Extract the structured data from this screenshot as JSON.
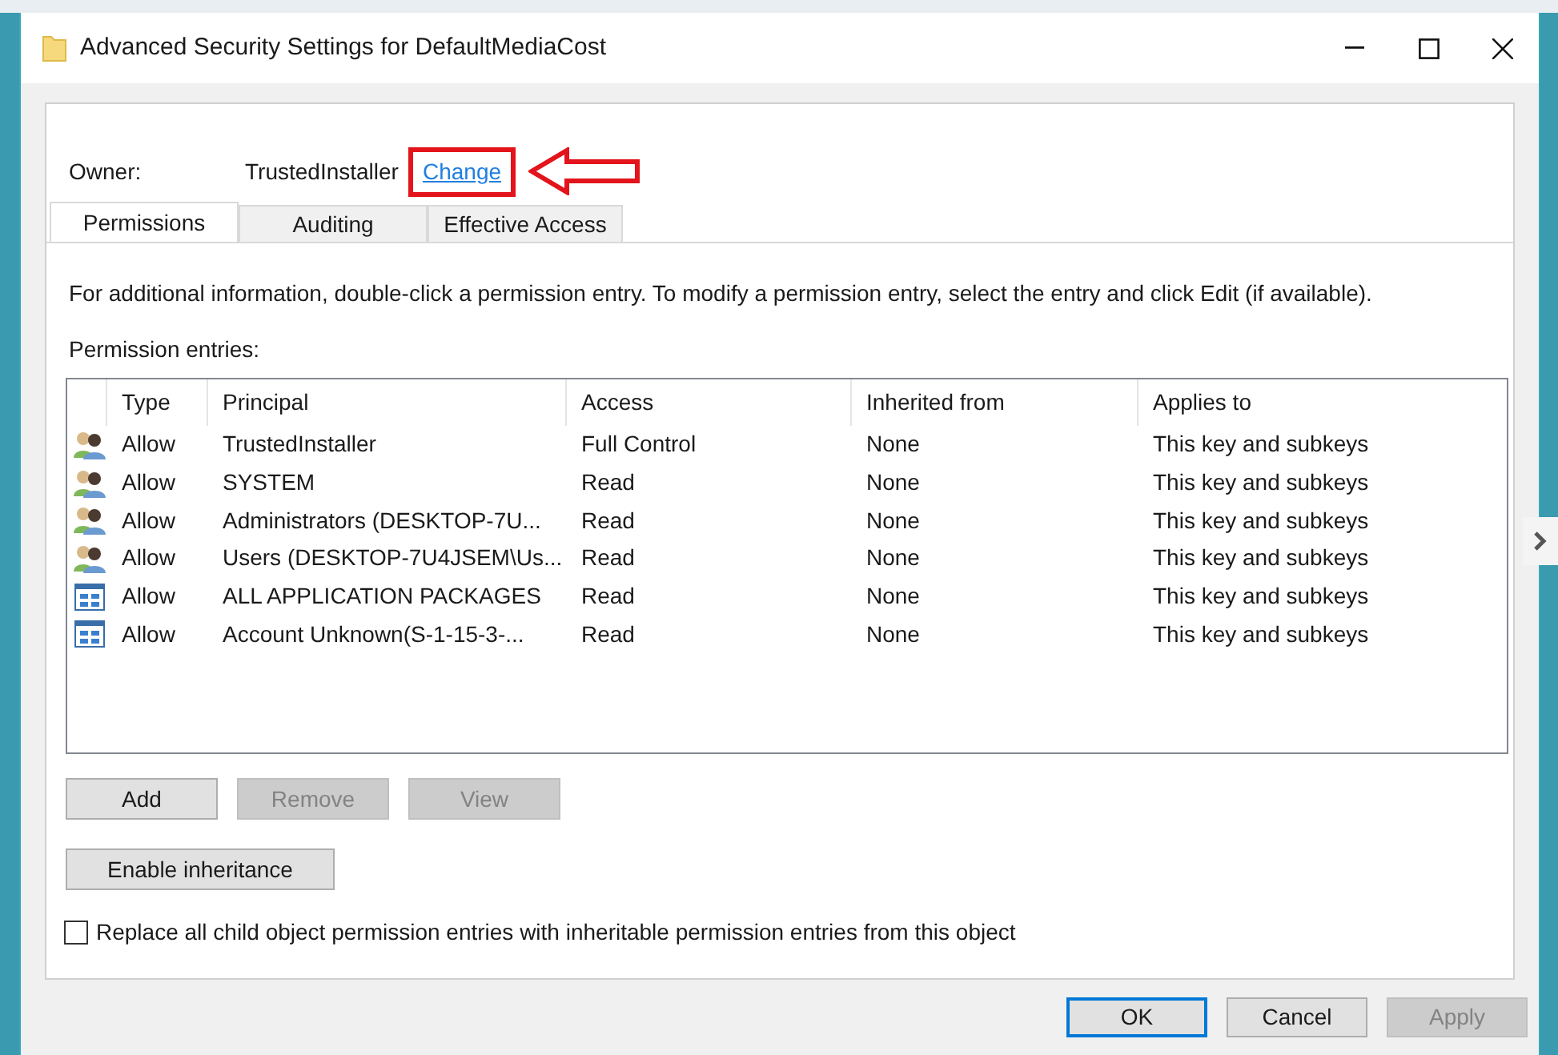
{
  "window": {
    "title": "Advanced Security Settings for DefaultMediaCost"
  },
  "owner": {
    "label": "Owner:",
    "value": "TrustedInstaller",
    "change_link": "Change",
    "highlighted": true
  },
  "tabs": [
    {
      "label": "Permissions",
      "selected": true
    },
    {
      "label": "Auditing",
      "selected": false
    },
    {
      "label": "Effective Access",
      "selected": false
    }
  ],
  "info": "For additional information, double-click a permission entry. To modify a permission entry, select the entry and click Edit (if available).",
  "entries_label": "Permission entries:",
  "table": {
    "columns": [
      "Type",
      "Principal",
      "Access",
      "Inherited from",
      "Applies to"
    ],
    "rows": [
      {
        "kind": "group",
        "cells": [
          "Allow",
          "TrustedInstaller",
          "Full Control",
          "None",
          "This key and subkeys"
        ]
      },
      {
        "kind": "group",
        "cells": [
          "Allow",
          "SYSTEM",
          "Read",
          "None",
          "This key and subkeys"
        ]
      },
      {
        "kind": "group",
        "cells": [
          "Allow",
          "Administrators (DESKTOP-7U...",
          "Read",
          "None",
          "This key and subkeys"
        ]
      },
      {
        "kind": "group",
        "cells": [
          "Allow",
          "Users (DESKTOP-7U4JSEM\\Us...",
          "Read",
          "None",
          "This key and subkeys"
        ]
      },
      {
        "kind": "app",
        "cells": [
          "Allow",
          "ALL APPLICATION PACKAGES",
          "Read",
          "None",
          "This key and subkeys"
        ]
      },
      {
        "kind": "app",
        "cells": [
          "Allow",
          "Account Unknown(S-1-15-3-...",
          "Read",
          "None",
          "This key and subkeys"
        ]
      }
    ]
  },
  "entry_buttons": [
    {
      "label": "Add",
      "disabled": false
    },
    {
      "label": "Remove",
      "disabled": true
    },
    {
      "label": "View",
      "disabled": true
    }
  ],
  "inheritance_button": "Enable inheritance",
  "replace_checkbox": {
    "label": "Replace all child object permission entries with inheritable permission entries from this object",
    "checked": false
  },
  "dialog_buttons": [
    {
      "label": "OK",
      "default": true,
      "disabled": false
    },
    {
      "label": "Cancel",
      "default": false,
      "disabled": false
    },
    {
      "label": "Apply",
      "default": false,
      "disabled": true
    }
  ]
}
